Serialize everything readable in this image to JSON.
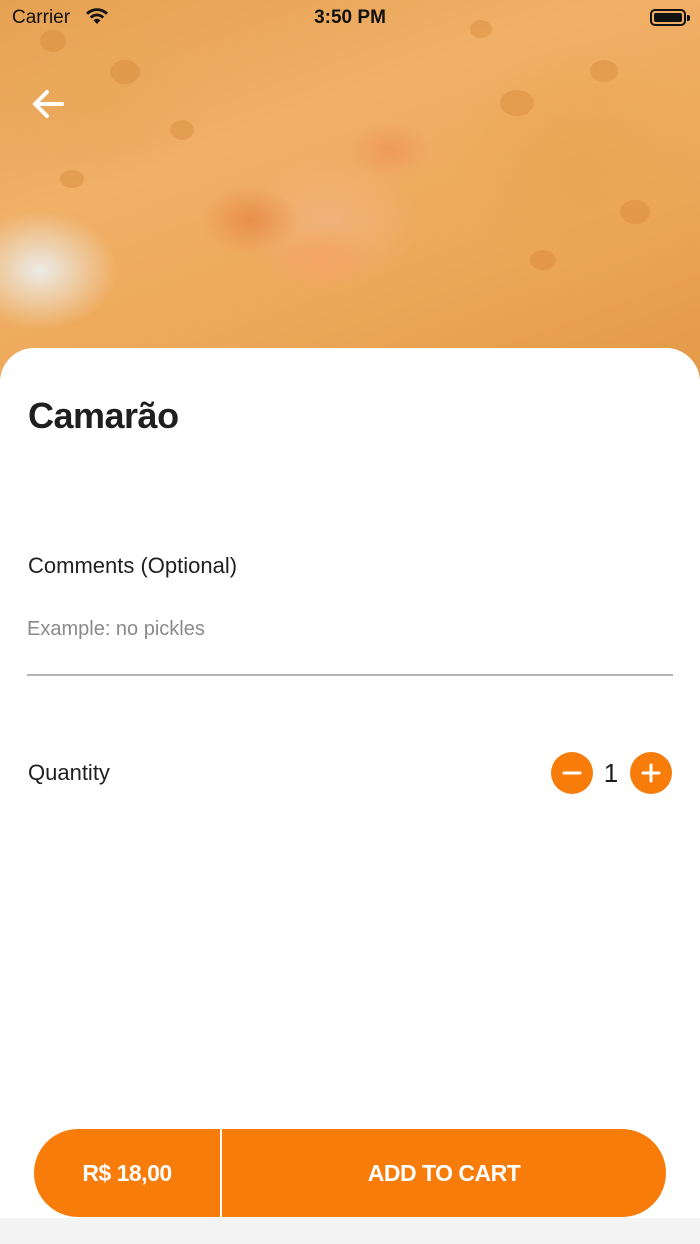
{
  "status_bar": {
    "carrier": "Carrier",
    "time": "3:50 PM",
    "icons": [
      "wifi-icon",
      "battery-icon"
    ]
  },
  "hero": {
    "image": "food-photo-camarao-pastel",
    "back_icon": "arrow-left-icon"
  },
  "product": {
    "name": "Camarão"
  },
  "comments": {
    "label": "Comments (Optional)",
    "placeholder": "Example: no pickles",
    "value": ""
  },
  "quantity": {
    "label": "Quantity",
    "value": "1",
    "decrement_icon": "minus-icon",
    "increment_icon": "plus-icon"
  },
  "cart": {
    "price": "R$ 18,00",
    "button_label": "ADD TO CART"
  },
  "colors": {
    "accent": "#f77c0a",
    "text": "#1f1f1f",
    "placeholder": "#8a8a8a"
  }
}
